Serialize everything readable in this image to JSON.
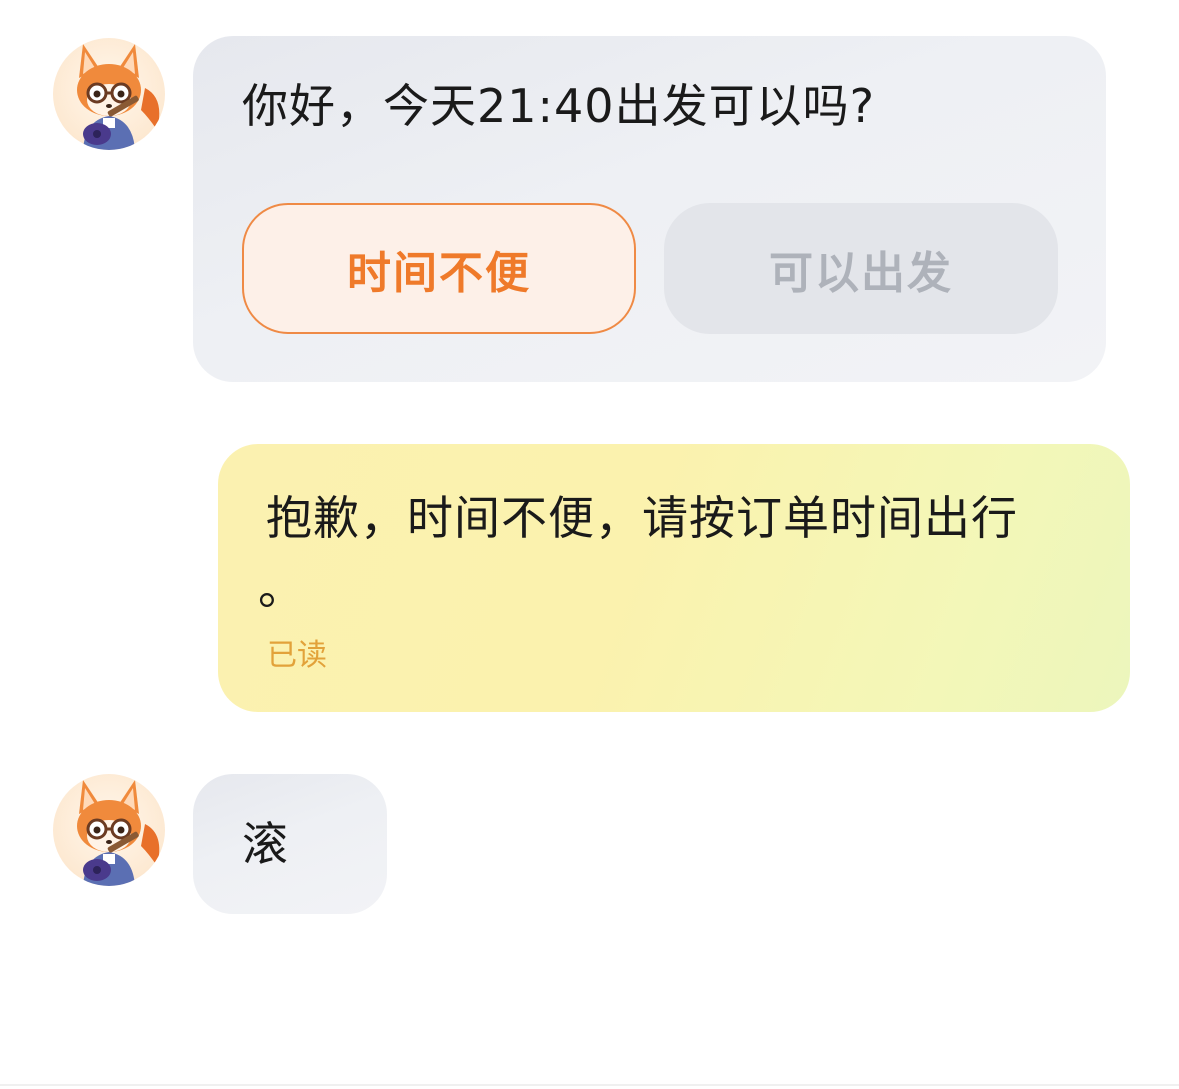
{
  "messages": [
    {
      "sender": "driver",
      "text": "你好，今天21:40出发可以吗?",
      "actions": {
        "decline_label": "时间不便",
        "accept_label": "可以出发"
      }
    },
    {
      "sender": "me",
      "text_line1": "抱歉，时间不便，请按订单时间出行",
      "text_line2": "。",
      "status": "已读"
    },
    {
      "sender": "driver",
      "text": "滚"
    }
  ],
  "colors": {
    "decline_button_text": "#ef7a2a",
    "decline_button_border": "#ef8a45",
    "accept_button_text": "#aeb2ba",
    "read_receipt": "#e2a23a",
    "outgoing_bubble": "#fbf1b0",
    "incoming_bubble": "#eef0f4"
  },
  "icons": {
    "avatar": "fox-with-glasses-guitar-avatar"
  }
}
